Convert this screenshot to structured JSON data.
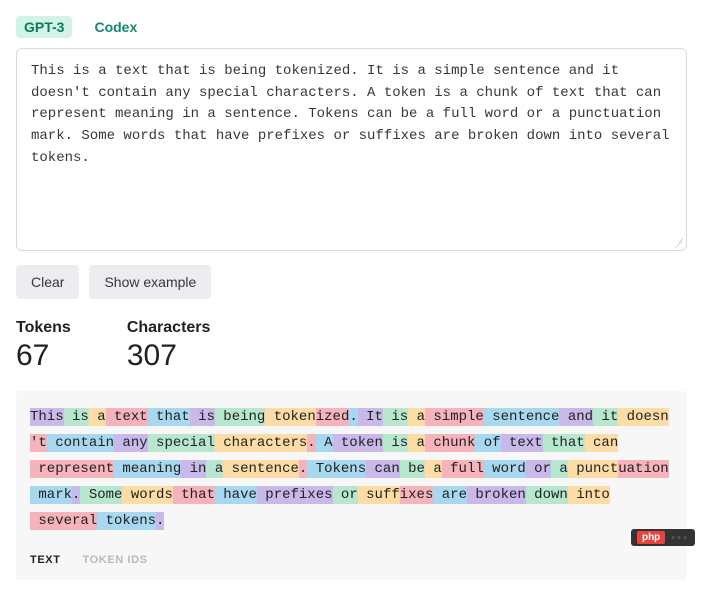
{
  "tabs": {
    "gpt3": "GPT-3",
    "codex": "Codex"
  },
  "textarea": {
    "value": "This is a text that is being tokenized. It is a simple sentence and it doesn't contain any special characters. A token is a chunk of text that can represent meaning in a sentence. Tokens can be a full word or a punctuation mark. Some words that have prefixes or suffixes are broken down into several tokens."
  },
  "buttons": {
    "clear": "Clear",
    "example": "Show example"
  },
  "stats": {
    "tokens_label": "Tokens",
    "tokens_value": "67",
    "chars_label": "Characters",
    "chars_value": "307"
  },
  "tokens": [
    "This",
    " is",
    " a",
    " text",
    " that",
    " is",
    " being",
    " token",
    "ized",
    ".",
    " It",
    " is",
    " a",
    " simple",
    " sentence",
    " and",
    " it",
    " doesn",
    "'t",
    " contain",
    " any",
    " special",
    " characters",
    ".",
    " A",
    " token",
    " is",
    " a",
    " chunk",
    " of",
    " text",
    " that",
    " can",
    " represent",
    " meaning",
    " in",
    " a",
    " sentence",
    ".",
    " Tokens",
    " can",
    " be",
    " a",
    " full",
    " word",
    " or",
    " a",
    " punct",
    "uation",
    " mark",
    ".",
    " Some",
    " words",
    " that",
    " have",
    " prefixes",
    " or",
    " suff",
    "ixes",
    " are",
    " broken",
    " down",
    " into",
    " several",
    " tokens",
    "."
  ],
  "sub_tabs": {
    "text": "TEXT",
    "ids": "TOKEN IDS"
  },
  "watermark": {
    "badge": "php",
    "text": "▪▪▪"
  }
}
